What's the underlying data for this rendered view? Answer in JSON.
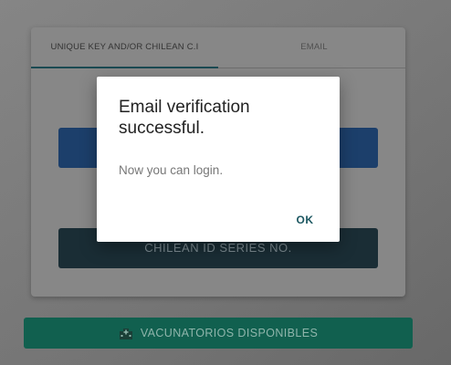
{
  "tabs": {
    "active_label": "UNIQUE KEY AND/OR CHILEAN C.I",
    "email_label": "EMAIL"
  },
  "form": {
    "id_series_button_label": "CHILEAN ID SERIES NO."
  },
  "footer": {
    "vacunatorios_button_label": "VACUNATORIOS DISPONIBLES",
    "vacunatorios_icon": "hospital-icon"
  },
  "dialog": {
    "title": "Email verification successful.",
    "message": "Now you can login.",
    "ok_label": "OK"
  },
  "colors": {
    "primary_teal": "#1b5660",
    "green_button": "#11604f",
    "blue_button": "#1c3f6b",
    "dark_button": "#1a2d35"
  }
}
